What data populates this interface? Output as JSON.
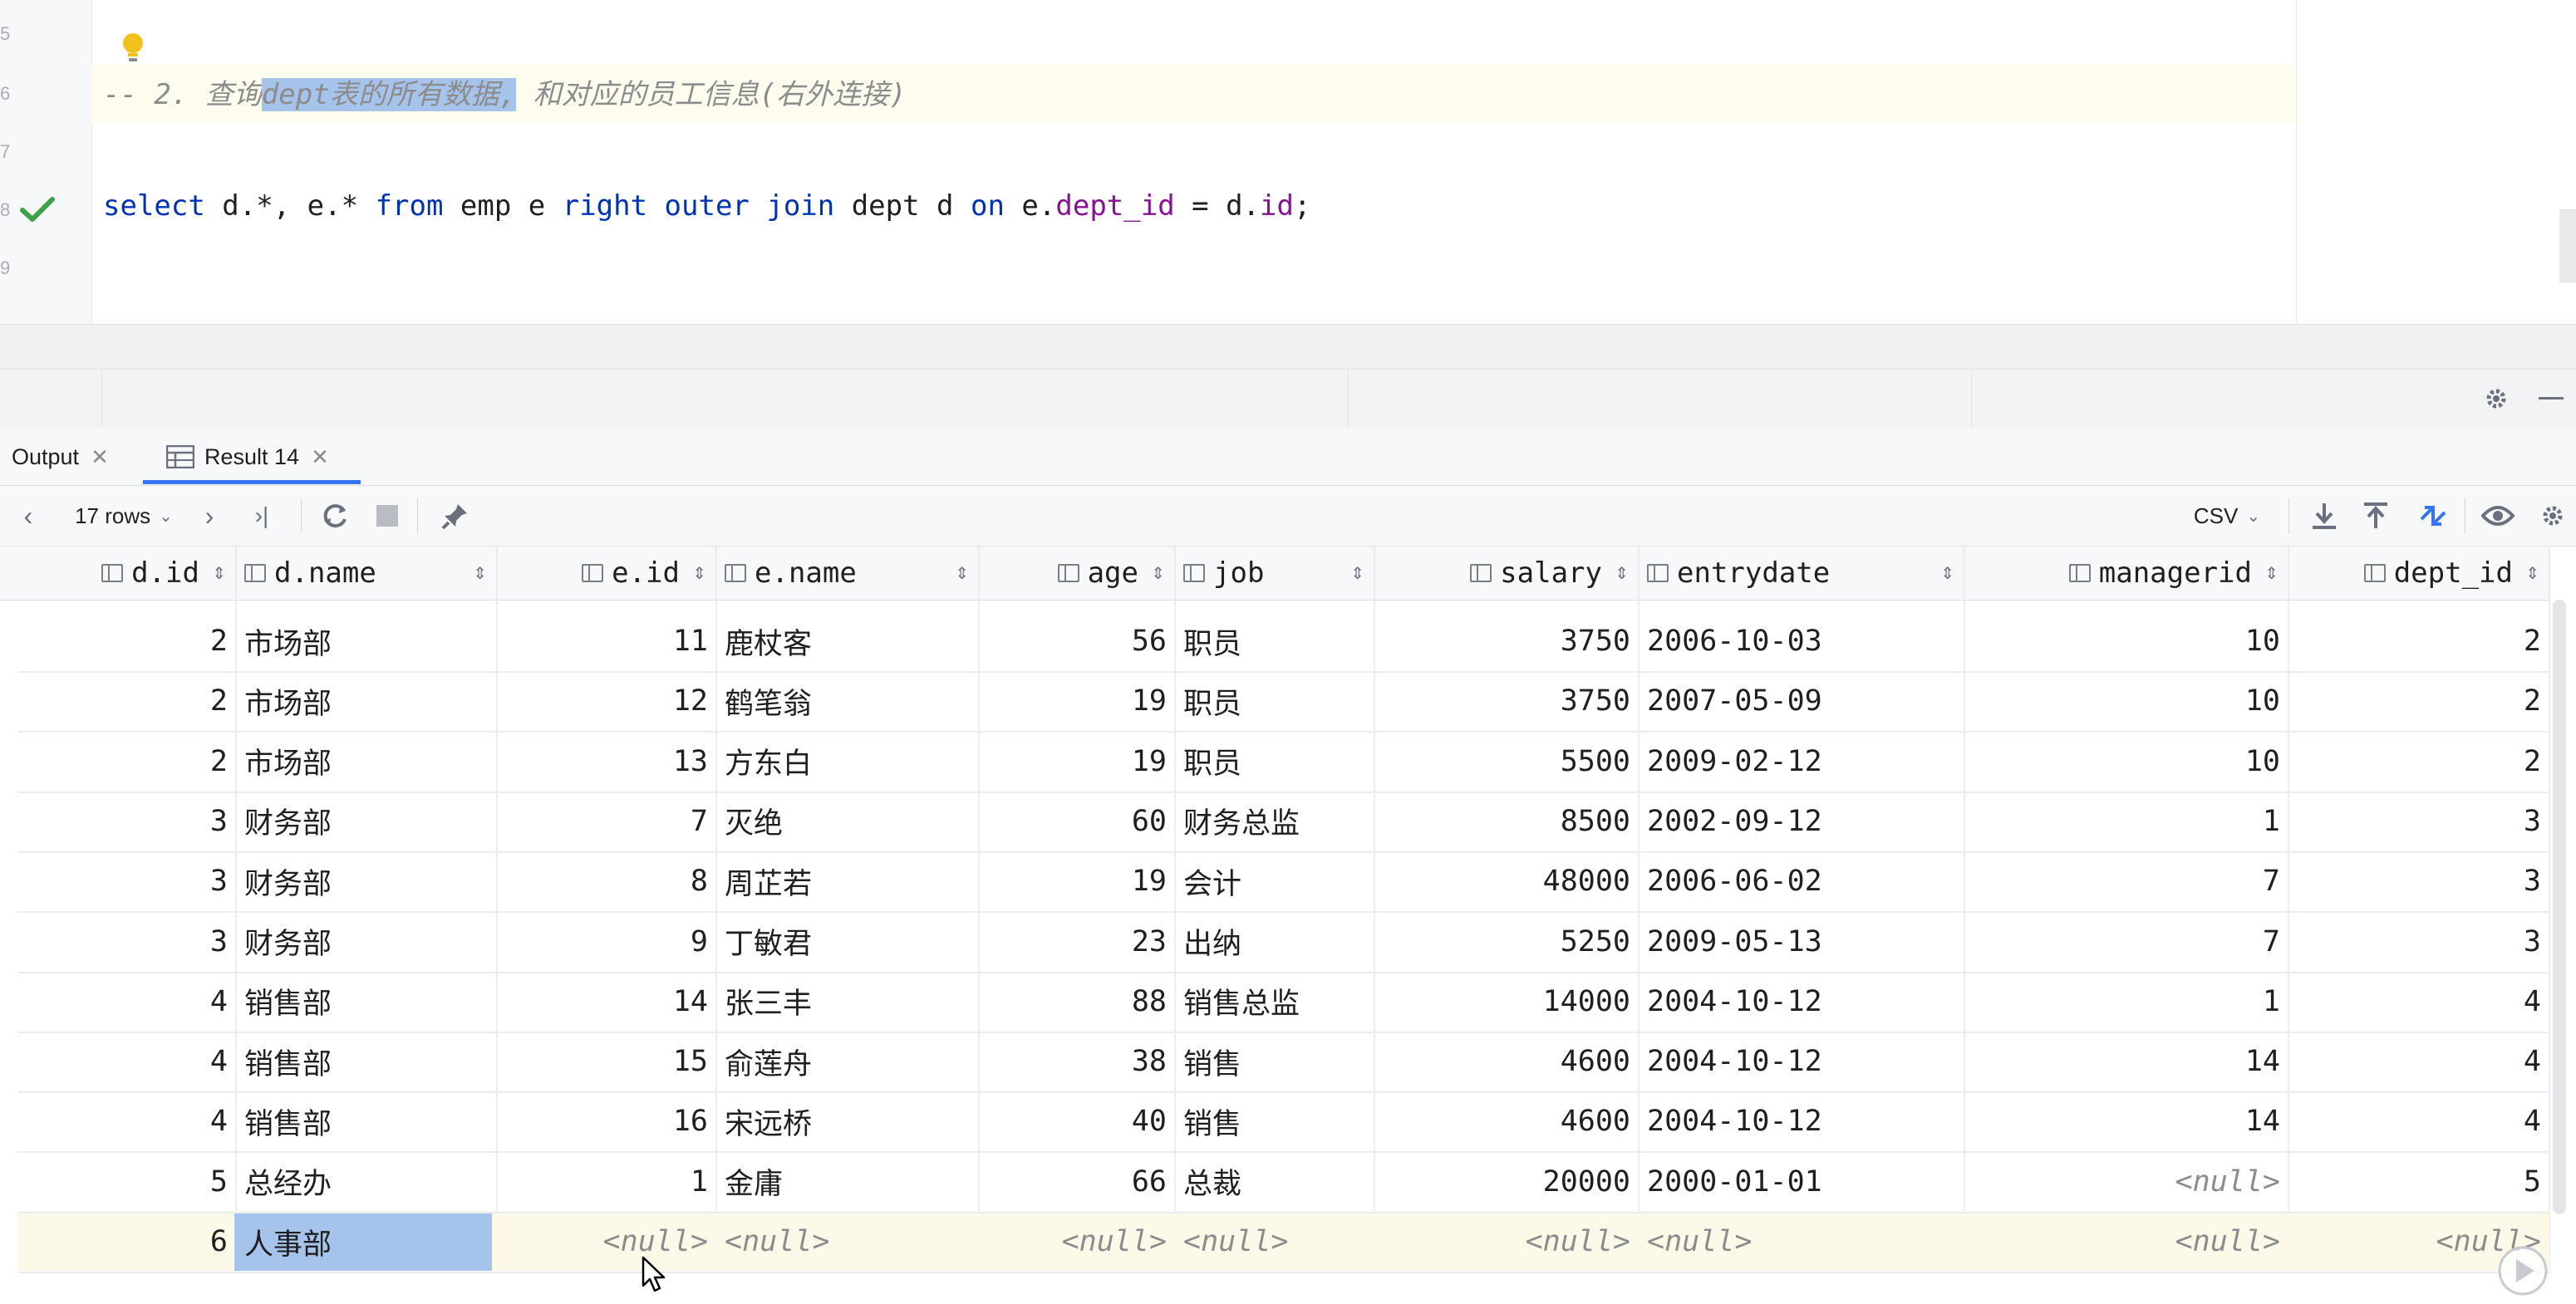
{
  "editor": {
    "line_numbers": [
      "5",
      "6",
      "7",
      "8",
      "9"
    ],
    "comment_prefix": "-- 2. 查询",
    "comment_selected": "dept表的所有数据,",
    "comment_rest": " 和对应的员工信息(右外连接)",
    "sql_tokens": [
      {
        "t": "select",
        "c": "kw"
      },
      {
        "t": " d.*, e.* ",
        "c": ""
      },
      {
        "t": "from",
        "c": "kw"
      },
      {
        "t": " emp e ",
        "c": ""
      },
      {
        "t": "right outer join",
        "c": "kw"
      },
      {
        "t": " dept d ",
        "c": ""
      },
      {
        "t": "on",
        "c": "kw"
      },
      {
        "t": " e.",
        "c": ""
      },
      {
        "t": "dept_id",
        "c": "fld"
      },
      {
        "t": " = d.",
        "c": ""
      },
      {
        "t": "id",
        "c": "fld"
      },
      {
        "t": ";",
        "c": ""
      }
    ]
  },
  "tabs": [
    {
      "label": "Output"
    },
    {
      "label": "Result 14"
    }
  ],
  "toolbar": {
    "rows_label": "17 rows",
    "export_format": "CSV"
  },
  "grid": {
    "columns": [
      "d.id",
      "d.name",
      "e.id",
      "e.name",
      "age",
      "job",
      "salary",
      "entrydate",
      "managerid",
      "dept_id"
    ],
    "rows": [
      [
        "2",
        "市场部",
        "11",
        "鹿杖客",
        "56",
        "职员",
        "3750",
        "2006-10-03",
        "10",
        "2"
      ],
      [
        "2",
        "市场部",
        "12",
        "鹤笔翁",
        "19",
        "职员",
        "3750",
        "2007-05-09",
        "10",
        "2"
      ],
      [
        "2",
        "市场部",
        "13",
        "方东白",
        "19",
        "职员",
        "5500",
        "2009-02-12",
        "10",
        "2"
      ],
      [
        "3",
        "财务部",
        "7",
        "灭绝",
        "60",
        "财务总监",
        "8500",
        "2002-09-12",
        "1",
        "3"
      ],
      [
        "3",
        "财务部",
        "8",
        "周芷若",
        "19",
        "会计",
        "48000",
        "2006-06-02",
        "7",
        "3"
      ],
      [
        "3",
        "财务部",
        "9",
        "丁敏君",
        "23",
        "出纳",
        "5250",
        "2009-05-13",
        "7",
        "3"
      ],
      [
        "4",
        "销售部",
        "14",
        "张三丰",
        "88",
        "销售总监",
        "14000",
        "2004-10-12",
        "1",
        "4"
      ],
      [
        "4",
        "销售部",
        "15",
        "俞莲舟",
        "38",
        "销售",
        "4600",
        "2004-10-12",
        "14",
        "4"
      ],
      [
        "4",
        "销售部",
        "16",
        "宋远桥",
        "40",
        "销售",
        "4600",
        "2004-10-12",
        "14",
        "4"
      ],
      [
        "5",
        "总经办",
        "1",
        "金庸",
        "66",
        "总裁",
        "20000",
        "2000-01-01",
        "<null>",
        "5"
      ],
      [
        "6",
        "人事部",
        "<null>",
        "<null>",
        "<null>",
        "<null>",
        "<null>",
        "<null>",
        "<null>",
        "<null>"
      ]
    ]
  },
  "colors": {
    "selection": "#a6c3ec",
    "keyword": "#0033b3",
    "field": "#871094",
    "accent": "#3574f0",
    "check": "#3da14a"
  }
}
